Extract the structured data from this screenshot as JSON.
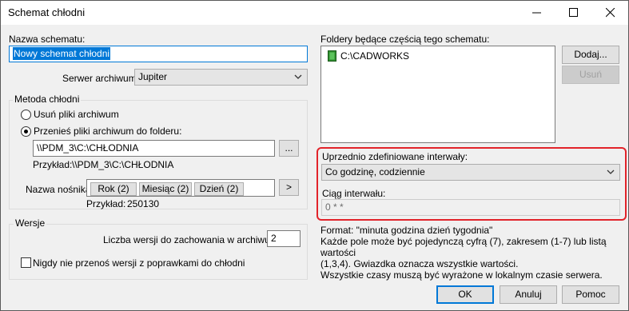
{
  "window": {
    "title": "Schemat chłodni"
  },
  "left": {
    "name_label": "Nazwa schematu:",
    "name_value": "Nowy schemat chłodni",
    "server_label": "Serwer archiwum:",
    "server_value": "Jupiter",
    "method_group": {
      "title": "Metoda chłodni",
      "delete_option": "Usuń pliki archiwum",
      "move_option": "Przenieś pliki archiwum do folderu:",
      "folder_value": "\\\\PDM_3\\C:\\CHŁODNIA",
      "browse_label": "...",
      "example_label": "Przykład:",
      "example_value": "\\\\PDM_3\\C:\\CHŁODNIA",
      "media_label": "Nazwa nośnika:",
      "media_buttons": [
        "Rok (2)",
        "Miesiąc (2)",
        "Dzień (2)"
      ],
      "arrow_label": ">",
      "media_example_label": "Przykład:",
      "media_example_value": "250130"
    },
    "versions_group": {
      "title": "Wersje",
      "count_label": "Liczba wersji do zachowania w archiwum:",
      "count_value": "2",
      "never_move_label": "Nigdy nie przenoś wersji z poprawkami do chłodni"
    }
  },
  "right": {
    "folders_label": "Foldery będące częścią tego schematu:",
    "folders": [
      "C:\\CADWORKS"
    ],
    "add_label": "Dodaj...",
    "remove_label": "Usuń",
    "intervals_label": "Uprzednio zdefiniowane interwały:",
    "intervals_value": "Co godzinę, codziennie",
    "string_label": "Ciąg interwału:",
    "string_value": "0 * *",
    "help_lines": [
      "Format: \"minuta godzina dzień tygodnia\"",
      "Każde pole może być pojedynczą cyfrą (7), zakresem (1-7) lub listą wartości",
      "(1,3,4). Gwiazdka oznacza wszystkie wartości.",
      "Wszystkie czasy muszą być wyrażone w lokalnym czasie serwera."
    ]
  },
  "footer": {
    "ok_label": "OK",
    "cancel_label": "Anuluj",
    "help_label": "Pomoc"
  },
  "colors": {
    "accent": "#0078d7",
    "highlight": "#e2232a"
  }
}
